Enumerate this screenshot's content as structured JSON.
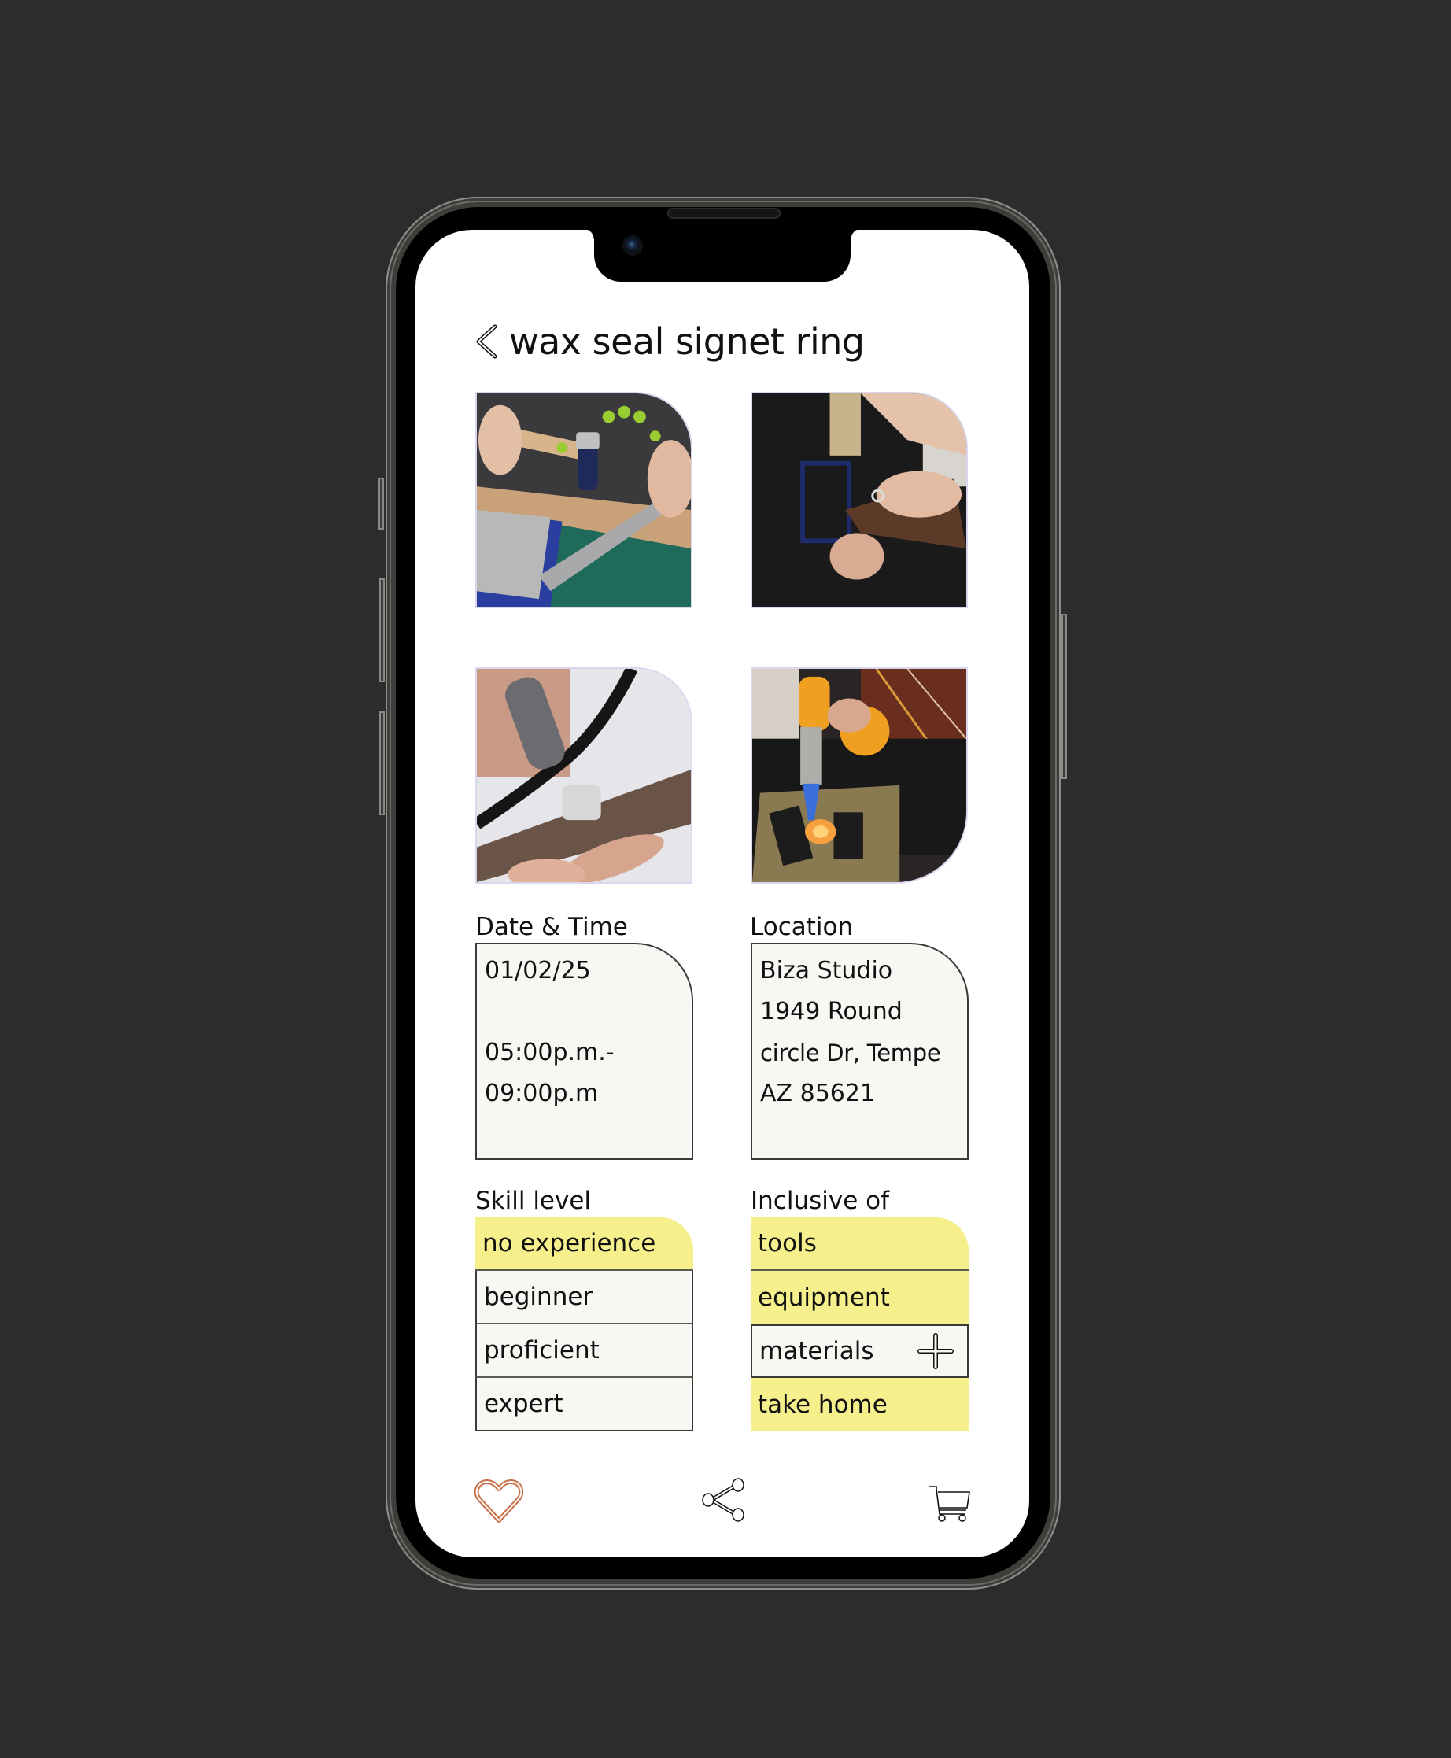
{
  "header": {
    "back_icon": "chevron-left-icon",
    "title": "wax seal signet ring"
  },
  "gallery": [
    {
      "alt": "hands hammering metal on a ring mandrel over a steel bench block"
    },
    {
      "alt": "hands sawing a ring with a jeweler's saw frame on a bench pin"
    },
    {
      "alt": "rotary tool polishing a wide silver ring on a finger"
    },
    {
      "alt": "orange butane torch soldering a ring on a soldering block"
    }
  ],
  "details": {
    "date_time": {
      "label": "Date & Time",
      "lines": [
        "01/02/25",
        "",
        "05:00p.m.-",
        "09:00p.m"
      ]
    },
    "location": {
      "label": "Location",
      "lines": [
        "Biza Studio",
        "1949 Round",
        "circle Dr, Tempe",
        "AZ 85621"
      ]
    }
  },
  "skill_level": {
    "label": "Skill level",
    "options": [
      {
        "label": "no experience",
        "selected": true
      },
      {
        "label": "beginner",
        "selected": false
      },
      {
        "label": "proficient",
        "selected": false
      },
      {
        "label": "expert",
        "selected": false
      }
    ]
  },
  "inclusive_of": {
    "label": "Inclusive of",
    "items": [
      {
        "label": "tools",
        "included": true
      },
      {
        "label": "equipment",
        "included": true
      },
      {
        "label": "materials",
        "included": false,
        "action_icon": "plus-icon"
      },
      {
        "label": "take home",
        "included": true
      }
    ]
  },
  "bottom_bar": {
    "icons": [
      "heart-icon",
      "share-icon",
      "cart-icon"
    ]
  },
  "colors": {
    "highlight": "#f5ef8c",
    "accent_heart": "#c8714a",
    "box_background": "#f8f7f4",
    "photo_border": "#d9d6ee",
    "page_background": "#2c2c2e"
  }
}
